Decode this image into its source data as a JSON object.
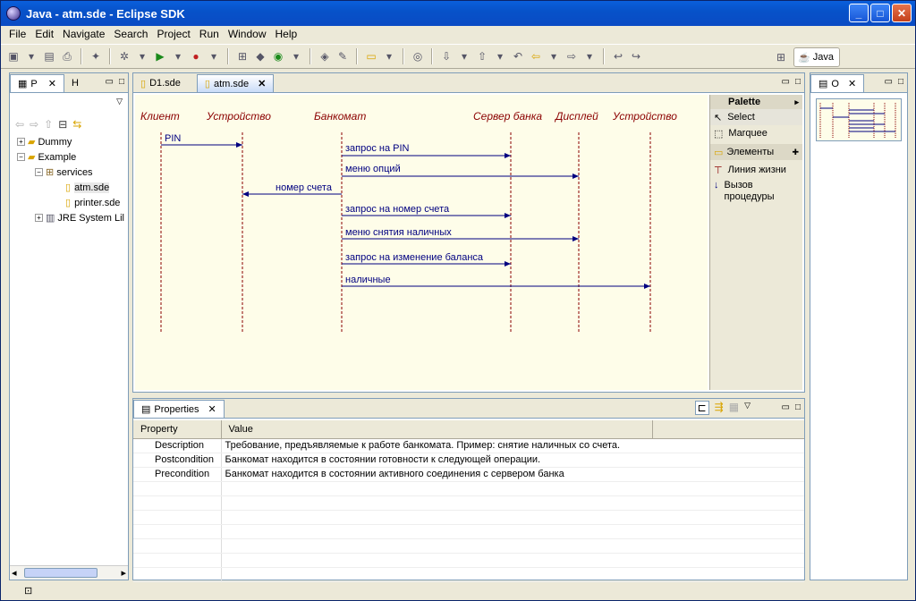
{
  "window": {
    "title": "Java - atm.sde - Eclipse SDK"
  },
  "menu": [
    "File",
    "Edit",
    "Navigate",
    "Search",
    "Project",
    "Run",
    "Window",
    "Help"
  ],
  "perspective": {
    "label": "Java"
  },
  "left_view": {
    "tabs": [
      {
        "label": "P"
      },
      {
        "label": "H"
      }
    ],
    "tree": [
      {
        "label": "Dummy",
        "level": 0,
        "expander": "+",
        "icon": "project-folder-icon"
      },
      {
        "label": "Example",
        "level": 0,
        "expander": "-",
        "icon": "project-folder-icon"
      },
      {
        "label": "services",
        "level": 1,
        "expander": "-",
        "icon": "package-icon"
      },
      {
        "label": "atm.sde",
        "level": 2,
        "expander": "",
        "icon": "sde-file-icon"
      },
      {
        "label": "printer.sde",
        "level": 2,
        "expander": "",
        "icon": "sde-file-icon"
      },
      {
        "label": "JRE System Lil",
        "level": 1,
        "expander": "+",
        "icon": "library-icon"
      }
    ]
  },
  "editor": {
    "tabs": [
      {
        "label": "D1.sde"
      },
      {
        "label": "atm.sde"
      }
    ],
    "diagram": {
      "lifelines": [
        "Клиент",
        "Устройство",
        "Банкомат",
        "Сервер банка",
        "Дисплей",
        "Устройство"
      ],
      "messages": [
        {
          "label": "PIN"
        },
        {
          "label": "запрос на PIN"
        },
        {
          "label": "меню опций"
        },
        {
          "label": "номер счета"
        },
        {
          "label": "запрос на номер счета"
        },
        {
          "label": "меню снятия наличных"
        },
        {
          "label": "запрос на изменение баланса"
        },
        {
          "label": "наличные"
        }
      ]
    },
    "palette": {
      "title": "Palette",
      "tools": [
        "Select",
        "Marquee"
      ],
      "drawer": "Элементы",
      "elements": [
        "Линия жизни",
        "Вызов процедуры"
      ]
    }
  },
  "properties": {
    "tab_label": "Properties",
    "columns": [
      "Property",
      "Value"
    ],
    "rows": [
      {
        "property": "Description",
        "value": "Требование, предъявляемые к работе банкомата. Пример: снятие наличных со счета."
      },
      {
        "property": "Postcondition",
        "value": "Банкомат находится в состоянии готовности к следующей операции."
      },
      {
        "property": "Precondition",
        "value": "Банкомат находится в состоянии активного соединения с сервером банка"
      }
    ]
  },
  "outline": {
    "tab_label": "O"
  },
  "colors": {
    "lifeline": "#8b0000",
    "message": "#000080",
    "diagram_bg": "#fefde9"
  }
}
